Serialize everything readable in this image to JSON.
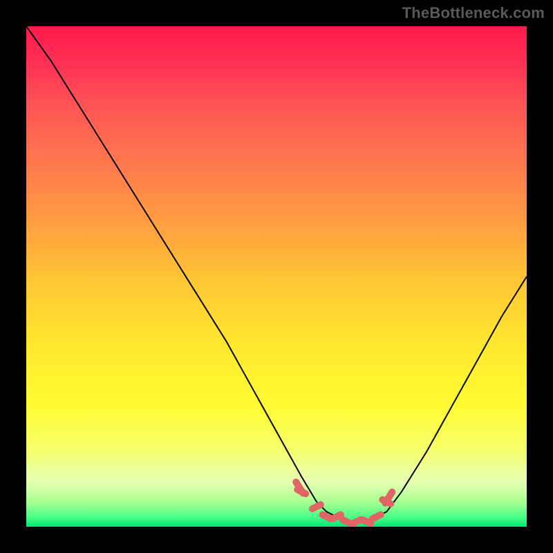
{
  "watermark": "TheBottleneck.com",
  "chart_data": {
    "type": "line",
    "title": "",
    "xlabel": "",
    "ylabel": "",
    "xlim": [
      0,
      100
    ],
    "ylim": [
      0,
      100
    ],
    "grid": false,
    "series": [
      {
        "name": "curve",
        "x": [
          0,
          5,
          10,
          15,
          20,
          25,
          30,
          35,
          40,
          45,
          50,
          55,
          58,
          60,
          62,
          64,
          66,
          68,
          70,
          72,
          75,
          80,
          85,
          90,
          95,
          100
        ],
        "y": [
          100,
          93,
          85,
          77,
          69,
          61,
          53,
          45,
          37,
          28,
          19,
          10,
          5,
          3,
          2,
          1,
          1,
          1,
          2,
          3,
          7,
          15,
          24,
          33,
          42,
          50
        ]
      }
    ],
    "highlight": {
      "name": "bottom-markers",
      "color": "#e06666",
      "x": [
        55,
        58,
        60,
        62,
        64,
        66,
        68,
        70,
        72
      ],
      "y": [
        7,
        4,
        2,
        2,
        1,
        1,
        1,
        2,
        5
      ]
    },
    "background_gradient": {
      "top": "#ff1a4d",
      "bottom": "#00e673",
      "description": "vertical red-yellow-green gradient"
    }
  }
}
